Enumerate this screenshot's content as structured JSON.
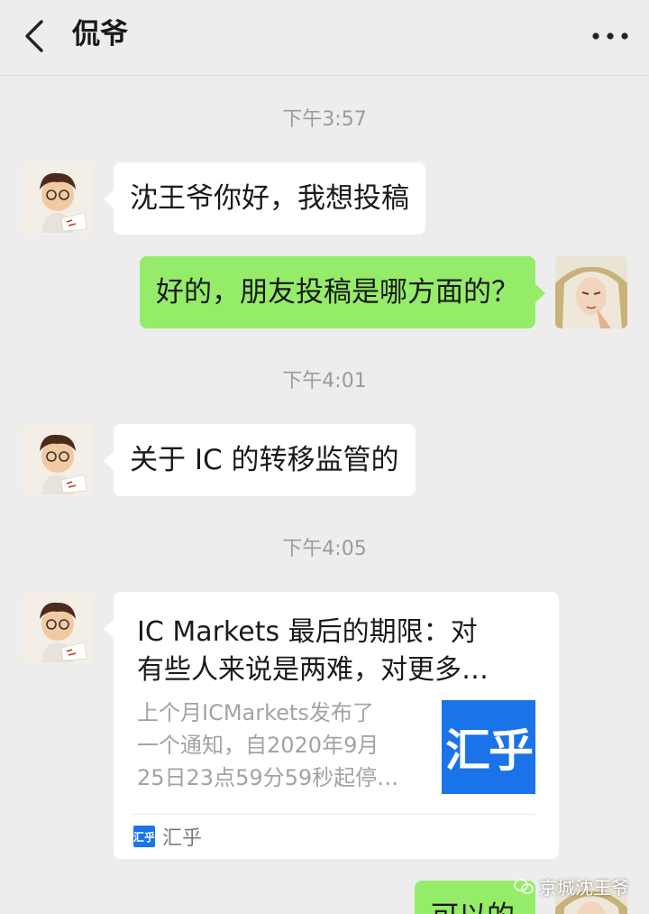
{
  "header": {
    "title": "侃爷"
  },
  "messages": [
    {
      "type": "time",
      "text": "下午3:57"
    },
    {
      "type": "in",
      "text": "沈王爷你好，我想投稿"
    },
    {
      "type": "out",
      "text": "好的，朋友投稿是哪方面的？"
    },
    {
      "type": "time",
      "text": "下午4:01"
    },
    {
      "type": "in",
      "text": "关于 IC 的转移监管的"
    },
    {
      "type": "time",
      "text": "下午4:05"
    },
    {
      "type": "card",
      "title_line1": "IC Markets 最后的期限：对",
      "title_line2": "有些人来说是两难，对更多…",
      "desc_line1": "上个月ICMarkets发布了",
      "desc_line2": "一个通知，自2020年9月",
      "desc_line3": "25日23点59分59秒起停…",
      "thumb_text": "汇乎",
      "source_icon_text": "汇乎",
      "source_label": "汇乎"
    },
    {
      "type": "out",
      "text": "可以的"
    }
  ],
  "watermark": {
    "text": "京城沈王爷"
  },
  "colors": {
    "background": "#ededed",
    "bubble_out": "#95ec69",
    "bubble_in": "#ffffff",
    "brand_blue": "#1a73e8"
  }
}
